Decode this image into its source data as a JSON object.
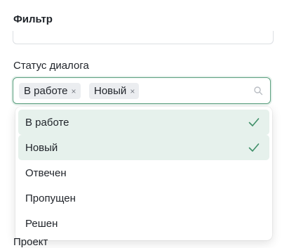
{
  "panel": {
    "title": "Фильтр"
  },
  "status_field": {
    "label": "Статус диалога",
    "tags": [
      {
        "label": "В работе",
        "remove": "×"
      },
      {
        "label": "Новый",
        "remove": "×"
      }
    ]
  },
  "dropdown": {
    "options": [
      {
        "label": "В работе",
        "selected": true
      },
      {
        "label": "Новый",
        "selected": true
      },
      {
        "label": "Отвечен",
        "selected": false
      },
      {
        "label": "Пропущен",
        "selected": false
      },
      {
        "label": "Решен",
        "selected": false
      }
    ]
  },
  "next_field": {
    "label": "Проект"
  },
  "colors": {
    "accent": "#5a9f7e",
    "selected_bg": "#e6f1ec",
    "tag_bg": "#ebedf0"
  },
  "icons": {
    "search": "search-icon",
    "check": "check-icon",
    "remove": "close-icon"
  }
}
